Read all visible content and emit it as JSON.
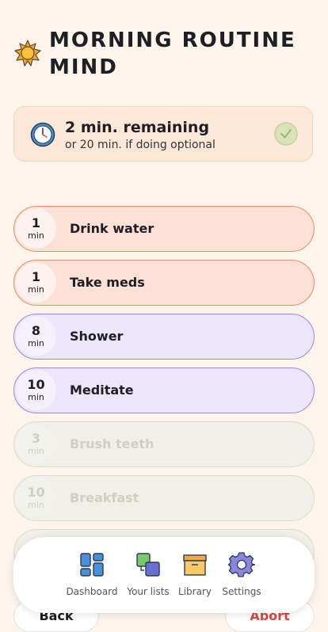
{
  "header": {
    "title": "Morning Routine Mind",
    "icon": "sun-icon"
  },
  "status": {
    "main": "2 min. remaining",
    "sub": "or 20 min. if doing optional"
  },
  "tasks": [
    {
      "num": "1",
      "unit": "min",
      "label": "Drink water",
      "style": "orange"
    },
    {
      "num": "1",
      "unit": "min",
      "label": "Take meds",
      "style": "orange"
    },
    {
      "num": "8",
      "unit": "min",
      "label": "Shower",
      "style": "purple"
    },
    {
      "num": "10",
      "unit": "min",
      "label": "Meditate",
      "style": "purple"
    },
    {
      "num": "3",
      "unit": "min",
      "label": "Brush teeth",
      "style": "disabled"
    },
    {
      "num": "10",
      "unit": "min",
      "label": "Breakfast",
      "style": "disabled"
    }
  ],
  "nav": {
    "dashboard": "Dashboard",
    "lists": "Your lists",
    "library": "Library",
    "settings": "Settings"
  },
  "buttons": {
    "back": "Back",
    "abort": "Abort"
  },
  "colors": {
    "orange_task": "#fde0d6",
    "purple_task": "#ebe6fc",
    "abort_text": "#e04545"
  }
}
